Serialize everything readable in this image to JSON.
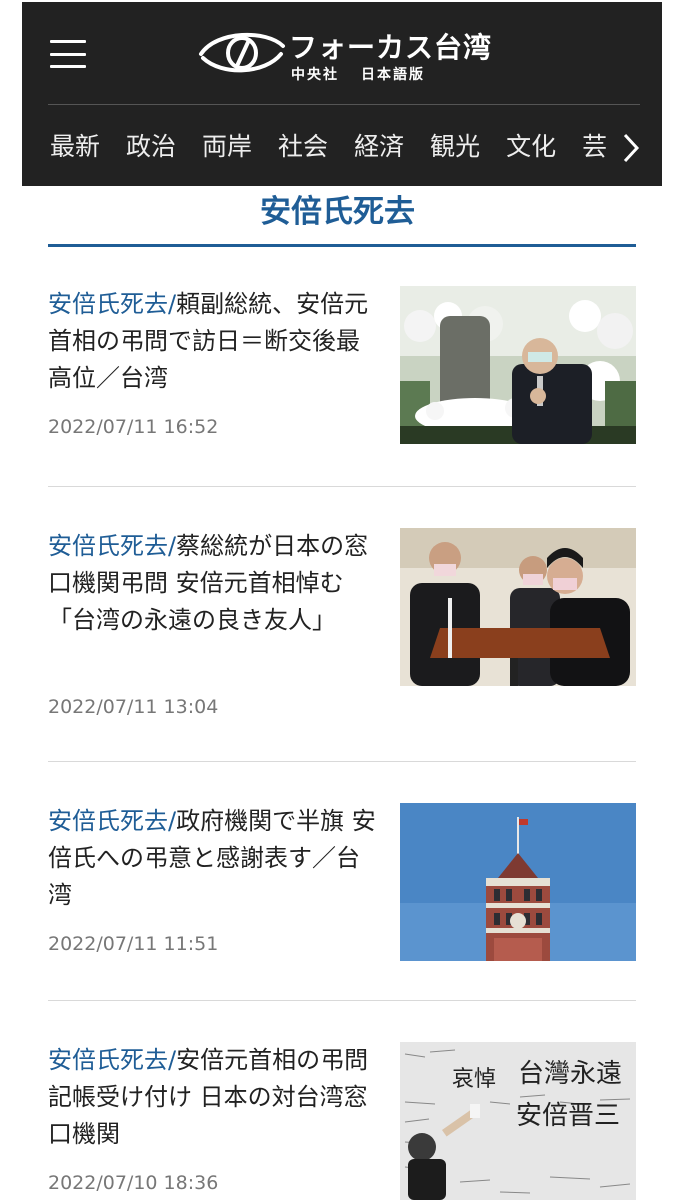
{
  "header": {
    "logo_main": "フォーカス台湾",
    "logo_sub_left": "中央社",
    "logo_sub_right": "日本語版",
    "nav": [
      "最新",
      "政治",
      "両岸",
      "社会",
      "経済",
      "観光",
      "文化",
      "芸"
    ]
  },
  "section": {
    "title": "安倍氏死去"
  },
  "articles": [
    {
      "category": "安倍氏死去/",
      "title": "頼副総統、安倍元首相の弔問で訪日＝断交後最高位／台湾",
      "date": "2022/07/11 16:52",
      "image": "funeral-altar-photo"
    },
    {
      "category": "安倍氏死去/",
      "title": "蔡総統が日本の窓口機関弔問 安倍元首相悼む「台湾の永遠の良き友人」",
      "date": "2022/07/11 13:04",
      "image": "president-condolence-photo"
    },
    {
      "category": "安倍氏死去/",
      "title": "政府機関で半旗 安倍氏への弔意と感謝表す／台湾",
      "date": "2022/07/11 11:51",
      "image": "presidential-office-tower-photo"
    },
    {
      "category": "安倍氏死去/",
      "title": "安倍元首相の弔問記帳受け付け 日本の対台湾窓口機関",
      "date": "2022/07/10 18:36",
      "image": "condolence-board-photo",
      "image_text": [
        "哀悼",
        "台灣永遠",
        "安倍晋三"
      ]
    }
  ],
  "colors": {
    "accent": "#1f5d96",
    "header_bg": "#222222",
    "date": "#777777",
    "divider": "#d9d9d9"
  }
}
